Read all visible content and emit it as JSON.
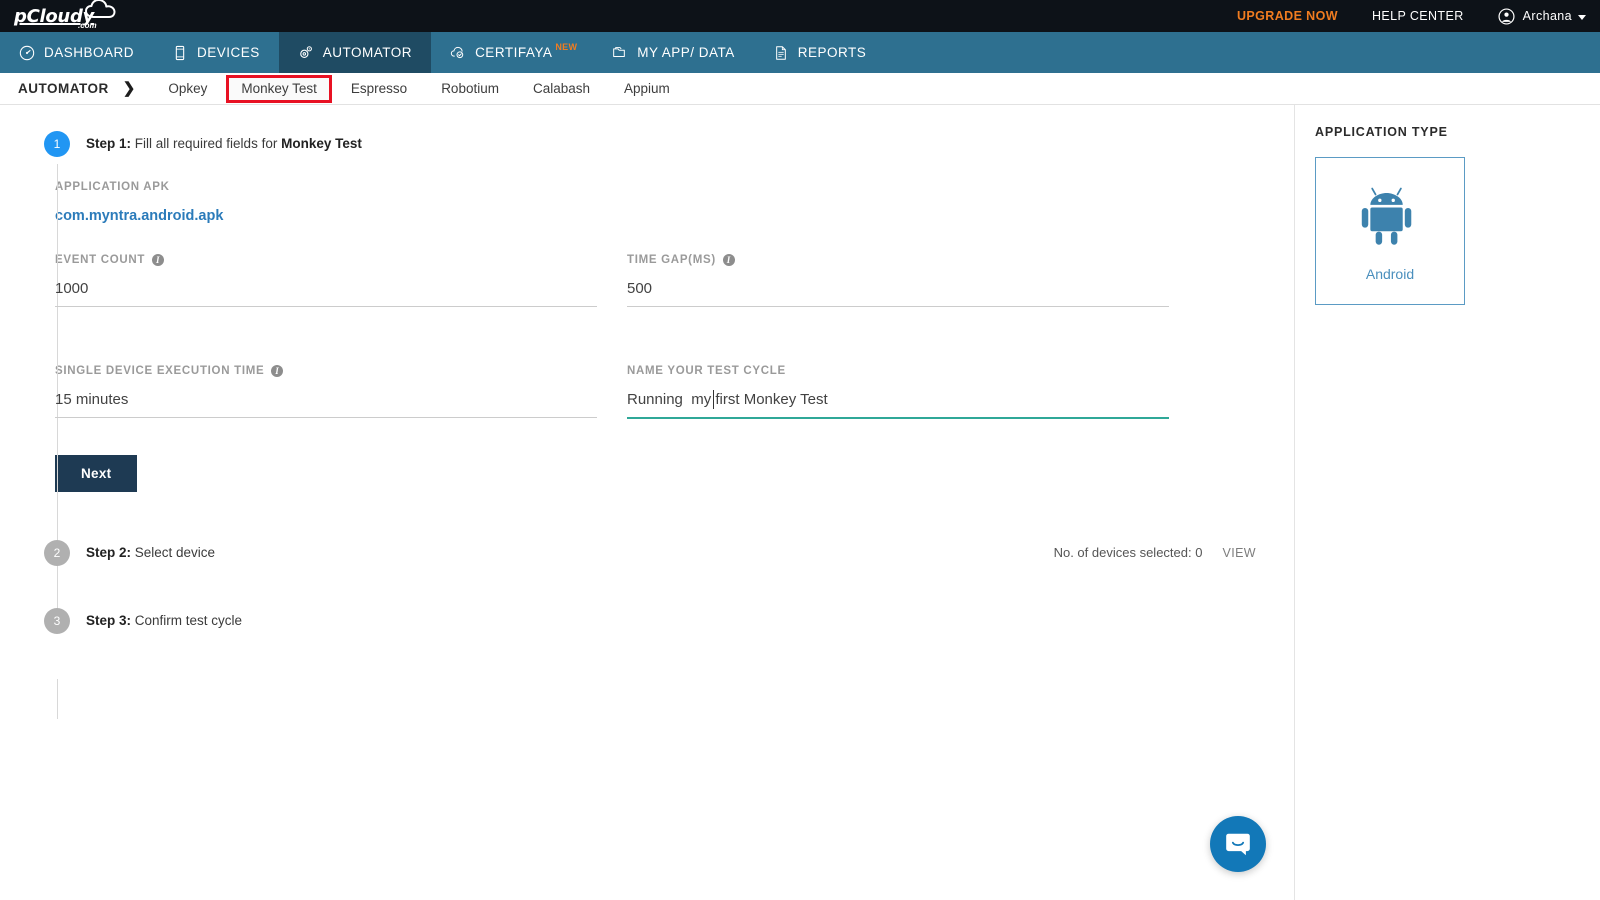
{
  "brand": {
    "logo_text": "pCloudy",
    "logo_suffix": ".com"
  },
  "topbar": {
    "upgrade_label": "UPGRADE NOW",
    "help_label": "HELP CENTER",
    "user_name": "Archana",
    "user_icon": "account-circle-icon",
    "caret_icon": "chevron-down-icon"
  },
  "mainnav": {
    "items": [
      {
        "label": "DASHBOARD",
        "icon": "speedometer-icon",
        "active": false,
        "badge": ""
      },
      {
        "label": "DEVICES",
        "icon": "mobile-phone-icon",
        "active": false,
        "badge": ""
      },
      {
        "label": "AUTOMATOR",
        "icon": "gear-icon",
        "active": true,
        "badge": ""
      },
      {
        "label": "CERTIFAYA",
        "icon": "cloud-check-icon",
        "active": false,
        "badge": "NEW"
      },
      {
        "label": "MY APP/ DATA",
        "icon": "folder-icon",
        "active": false,
        "badge": ""
      },
      {
        "label": "REPORTS",
        "icon": "document-icon",
        "active": false,
        "badge": ""
      }
    ]
  },
  "subnav": {
    "title": "AUTOMATOR",
    "arrow": "❯",
    "tabs": [
      {
        "label": "Opkey",
        "selected": false
      },
      {
        "label": "Monkey Test",
        "selected": true
      },
      {
        "label": "Espresso",
        "selected": false
      },
      {
        "label": "Robotium",
        "selected": false
      },
      {
        "label": "Calabash",
        "selected": false
      },
      {
        "label": "Appium",
        "selected": false
      }
    ]
  },
  "steps": {
    "step1": {
      "number": "1",
      "prefix": "Step 1:",
      "text": " Fill all required fields for ",
      "emphasis": "Monkey Test"
    },
    "step2": {
      "number": "2",
      "prefix": "Step 2:",
      "text": " Select device",
      "devices_selected": "No. of devices selected: 0",
      "view_label": "VIEW"
    },
    "step3": {
      "number": "3",
      "prefix": "Step 3:",
      "text": " Confirm test cycle"
    }
  },
  "form": {
    "apk_label": "APPLICATION APK",
    "apk_value": "com.myntra.android.apk",
    "event_count": {
      "label": "EVENT COUNT",
      "info_icon": "info-icon",
      "value": "1000"
    },
    "time_gap": {
      "label": "TIME GAP(ms)",
      "info_icon": "info-icon",
      "value": "500"
    },
    "execution_time": {
      "label": "SINGLE DEVICE EXECUTION TIME",
      "info_icon": "info-icon",
      "value": "15 minutes"
    },
    "test_cycle_name": {
      "label": "NAME YOUR TEST CYCLE",
      "value": "Running  my first Monkey Test"
    },
    "next_button": "Next"
  },
  "right_panel": {
    "title": "APPLICATION TYPE",
    "app_type": {
      "label": "Android",
      "icon": "android-robot-icon",
      "selected": true
    }
  },
  "widgets": {
    "intercom_icon": "chat-bubble-icon"
  },
  "colors": {
    "header_dark": "#0d1218",
    "nav_teal": "#2e7090",
    "nav_active": "#1f4b63",
    "accent_orange": "#f07c20",
    "highlight_red": "#e81123",
    "link_blue": "#2b7bba",
    "step_active_blue": "#2196f3",
    "step_inactive_gray": "#b0b0b0",
    "focus_teal": "#2fa898",
    "button_navy": "#1e3a53",
    "android_blue": "#3d82ad",
    "intercom_blue": "#1278b8"
  }
}
